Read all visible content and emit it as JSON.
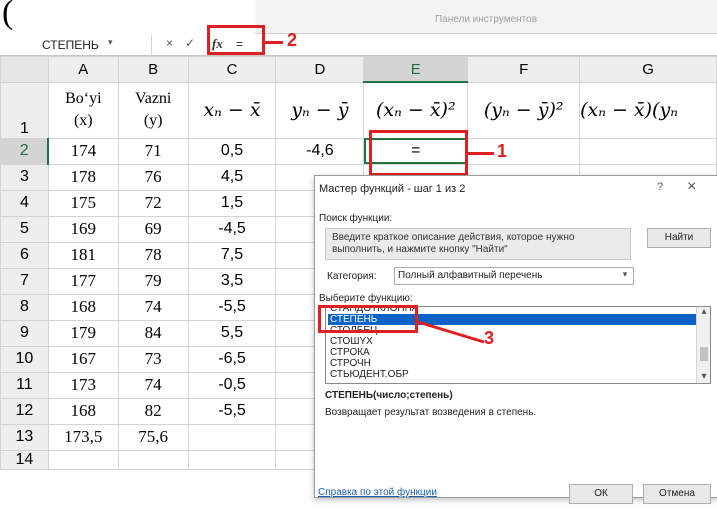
{
  "top_fragment": "(",
  "toolbar_caption": "Панели инструментов",
  "formula_bar": {
    "name_box": "СТЕПЕНЬ",
    "name_arrow": "▾",
    "cancel_icon": "×",
    "enter_icon": "✓",
    "fx_label": "fx",
    "value": "="
  },
  "annotations": {
    "one": "1",
    "two": "2",
    "three": "3"
  },
  "columns": [
    "A",
    "B",
    "C",
    "D",
    "E",
    "F",
    "G"
  ],
  "header_row": {
    "row_num": "1",
    "a": "Bo‘yi\n(x)",
    "b": "Vazni\n(y)",
    "c": "xₙ − x̄",
    "d": "yₙ − ȳ",
    "e": "(xₙ − x̄)²",
    "f": "(yₙ − ȳ)²",
    "g": "(xₙ − x̄)(yₙ"
  },
  "rows": [
    {
      "n": "2",
      "a": "174",
      "b": "71",
      "c": "0,5",
      "d": "-4,6",
      "e": "="
    },
    {
      "n": "3",
      "a": "178",
      "b": "76",
      "c": "4,5",
      "d": "",
      "e": ""
    },
    {
      "n": "4",
      "a": "175",
      "b": "72",
      "c": "1,5",
      "d": "",
      "e": ""
    },
    {
      "n": "5",
      "a": "169",
      "b": "69",
      "c": "-4,5",
      "d": "",
      "e": ""
    },
    {
      "n": "6",
      "a": "181",
      "b": "78",
      "c": "7,5",
      "d": "",
      "e": ""
    },
    {
      "n": "7",
      "a": "177",
      "b": "79",
      "c": "3,5",
      "d": "",
      "e": ""
    },
    {
      "n": "8",
      "a": "168",
      "b": "74",
      "c": "-5,5",
      "d": "",
      "e": ""
    },
    {
      "n": "9",
      "a": "179",
      "b": "84",
      "c": "5,5",
      "d": "",
      "e": ""
    },
    {
      "n": "10",
      "a": "167",
      "b": "73",
      "c": "-6,5",
      "d": "",
      "e": ""
    },
    {
      "n": "11",
      "a": "173",
      "b": "74",
      "c": "-0,5",
      "d": "",
      "e": ""
    },
    {
      "n": "12",
      "a": "168",
      "b": "82",
      "c": "-5,5",
      "d": "",
      "e": ""
    },
    {
      "n": "13",
      "a": "173,5",
      "b": "75,6",
      "c": "",
      "d": "",
      "e": ""
    },
    {
      "n": "14",
      "a": "",
      "b": "",
      "c": "",
      "d": "",
      "e": ""
    }
  ],
  "dialog": {
    "title": "Мастер функций - шаг 1 из 2",
    "help_icon": "?",
    "close_icon": "×",
    "search_label": "Поиск функции:",
    "search_text": "Введите краткое описание действия, которое нужно выполнить, и нажмите кнопку \"Найти\"",
    "find_button": "Найти",
    "category_label": "Категория:",
    "category_value": "Полный алфавитный перечень",
    "category_arrow": "▾",
    "choose_label": "Выберите функцию:",
    "functions": [
      "СТАНДОТКЛОНПА",
      "СТЕПЕНЬ",
      "СТОЛБЕЦ",
      "СТОШYX",
      "СТРОКА",
      "СТРОЧН",
      "СТЬЮДЕНТ.ОБР"
    ],
    "selected_function": "СТЕПЕНЬ",
    "scroll_up": "▴",
    "scroll_down": "▾",
    "syntax": "СТЕПЕНЬ(число;степень)",
    "description": "Возвращает результат возведения в степень.",
    "help_link": "Справка по этой функции",
    "ok_button": "ОК",
    "cancel_button": "Отмена"
  },
  "colors": {
    "annotation_red": "#e02020",
    "selection_blue": "#0a64c8",
    "excel_green": "#217346"
  }
}
